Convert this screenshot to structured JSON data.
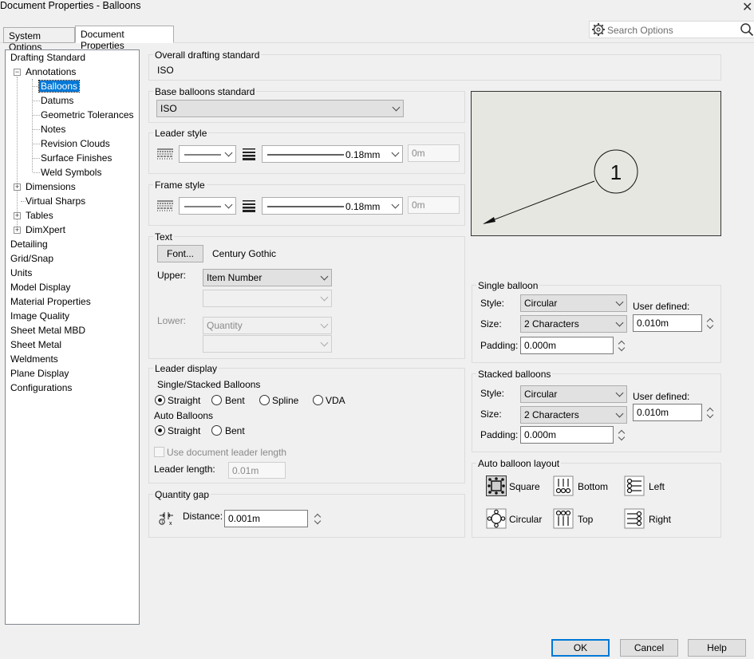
{
  "window": {
    "title": "Document Properties - Balloons",
    "close": "✕"
  },
  "tabs": [
    "System Options",
    "Document Properties"
  ],
  "search": {
    "placeholder": "Search Options"
  },
  "tree": {
    "drafting_standard": "Drafting Standard",
    "annotations": "Annotations",
    "balloons": "Balloons",
    "datums": "Datums",
    "geometric_tolerances": "Geometric Tolerances",
    "notes": "Notes",
    "revision_clouds": "Revision Clouds",
    "surface_finishes": "Surface Finishes",
    "weld_symbols": "Weld Symbols",
    "dimensions": "Dimensions",
    "virtual_sharps": "Virtual Sharps",
    "tables": "Tables",
    "dimxpert": "DimXpert",
    "detailing": "Detailing",
    "grid_snap": "Grid/Snap",
    "units": "Units",
    "model_display": "Model Display",
    "material_properties": "Material Properties",
    "image_quality": "Image Quality",
    "sheet_metal_mbd": "Sheet Metal MBD",
    "sheet_metal": "Sheet Metal",
    "weldments": "Weldments",
    "plane_display": "Plane Display",
    "configurations": "Configurations"
  },
  "overall": {
    "label": "Overall drafting standard",
    "value": "ISO"
  },
  "base": {
    "label": "Base balloons standard",
    "value": "ISO"
  },
  "leader_style": {
    "label": "Leader style",
    "thickness": "0.18mm",
    "custom": "0m"
  },
  "frame_style": {
    "label": "Frame style",
    "thickness": "0.18mm",
    "custom": "0m"
  },
  "text": {
    "label": "Text",
    "font_button": "Font...",
    "font_name": "Century Gothic",
    "upper_label": "Upper:",
    "upper_value": "Item Number",
    "lower_label": "Lower:",
    "lower_value": "Quantity"
  },
  "leader_display": {
    "label": "Leader display",
    "single_stacked": "Single/Stacked Balloons",
    "straight": "Straight",
    "bent": "Bent",
    "spline": "Spline",
    "vda": "VDA",
    "auto": "Auto Balloons",
    "auto_straight": "Straight",
    "auto_bent": "Bent",
    "use_doc_length": "Use document leader length",
    "length_label": "Leader length:",
    "length_value": "0.01m"
  },
  "quantity_gap": {
    "label": "Quantity gap",
    "distance_label": "Distance:",
    "distance_value": "0.001m"
  },
  "preview": {
    "balloon_text": "1"
  },
  "single_balloon": {
    "label": "Single balloon",
    "style_label": "Style:",
    "style_value": "Circular",
    "size_label": "Size:",
    "size_value": "2 Characters",
    "user_defined": "User defined:",
    "user_value": "0.010m",
    "padding_label": "Padding:",
    "padding_value": "0.000m"
  },
  "stacked_balloons": {
    "label": "Stacked balloons",
    "style_label": "Style:",
    "style_value": "Circular",
    "size_label": "Size:",
    "size_value": "2 Characters",
    "user_defined": "User defined:",
    "user_value": "0.010m",
    "padding_label": "Padding:",
    "padding_value": "0.000m"
  },
  "auto_layout": {
    "label": "Auto balloon layout",
    "square": "Square",
    "bottom": "Bottom",
    "left": "Left",
    "circular": "Circular",
    "top": "Top",
    "right": "Right"
  },
  "buttons": {
    "ok": "OK",
    "cancel": "Cancel",
    "help": "Help"
  },
  "colors": {
    "selection": "#0078d7",
    "preview_bg": "#e7e7e1",
    "dialog_bg": "#f0f0f0"
  }
}
